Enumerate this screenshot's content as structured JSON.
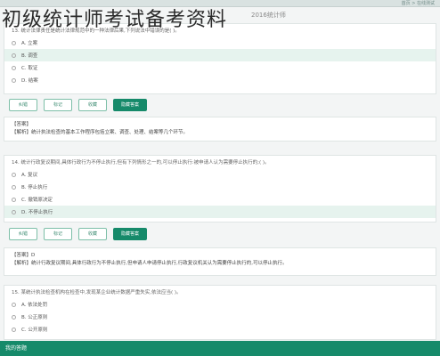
{
  "watermark": "初级统计师考试备考资料",
  "topbar": {
    "crumb": "首页 > 在线测试"
  },
  "tab_title": "2016统计师",
  "q13": {
    "stem": "13. 统计法律责任是统计法律规范中的一种法律后果,下列说法中错误的是( )。",
    "options": [
      {
        "label": "A. 立案",
        "selected": false
      },
      {
        "label": "B. 调查",
        "selected": true
      },
      {
        "label": "C. 取证",
        "selected": false
      },
      {
        "label": "D. 结案",
        "selected": false
      }
    ]
  },
  "buttons1": {
    "answer": "隐藏答案",
    "collect": "收藏",
    "mark": "标记",
    "correct": "纠错"
  },
  "answer1": {
    "label": "【答案】",
    "text": "【解析】统计执法检查的基本工作程序包括立案、调查、处理、结案等几个环节。"
  },
  "q14": {
    "stem": "14. 统计行政复议期间,具体行政行为不停止执行,但有下列情形之一的,可以停止执行:被申请人认为需要停止执行的;( )。",
    "options": [
      {
        "label": "A. 复议",
        "selected": false
      },
      {
        "label": "B. 停止执行",
        "selected": false
      },
      {
        "label": "C. 撤销原决定",
        "selected": false
      },
      {
        "label": "D. 不停止执行",
        "selected": true
      }
    ]
  },
  "buttons2": {
    "answer": "隐藏答案",
    "collect": "收藏",
    "mark": "标记",
    "correct": "纠错"
  },
  "answer2": {
    "label": "【答案】D",
    "text": "【解析】统计行政复议期间,具体行政行为不停止执行,但申请人申请停止执行,行政复议机关认为需要停止执行的,可以停止执行。"
  },
  "q15": {
    "stem": "15. 某统计执法检查机构在检查中,发现某企业统计数据严重失实,依法应当( )。",
    "options": [
      {
        "label": "A. 依法处罚",
        "selected": false
      },
      {
        "label": "B. 公正原则",
        "selected": false
      },
      {
        "label": "C. 公开原则",
        "selected": false
      }
    ]
  },
  "footer": {
    "label": "我的答题"
  }
}
